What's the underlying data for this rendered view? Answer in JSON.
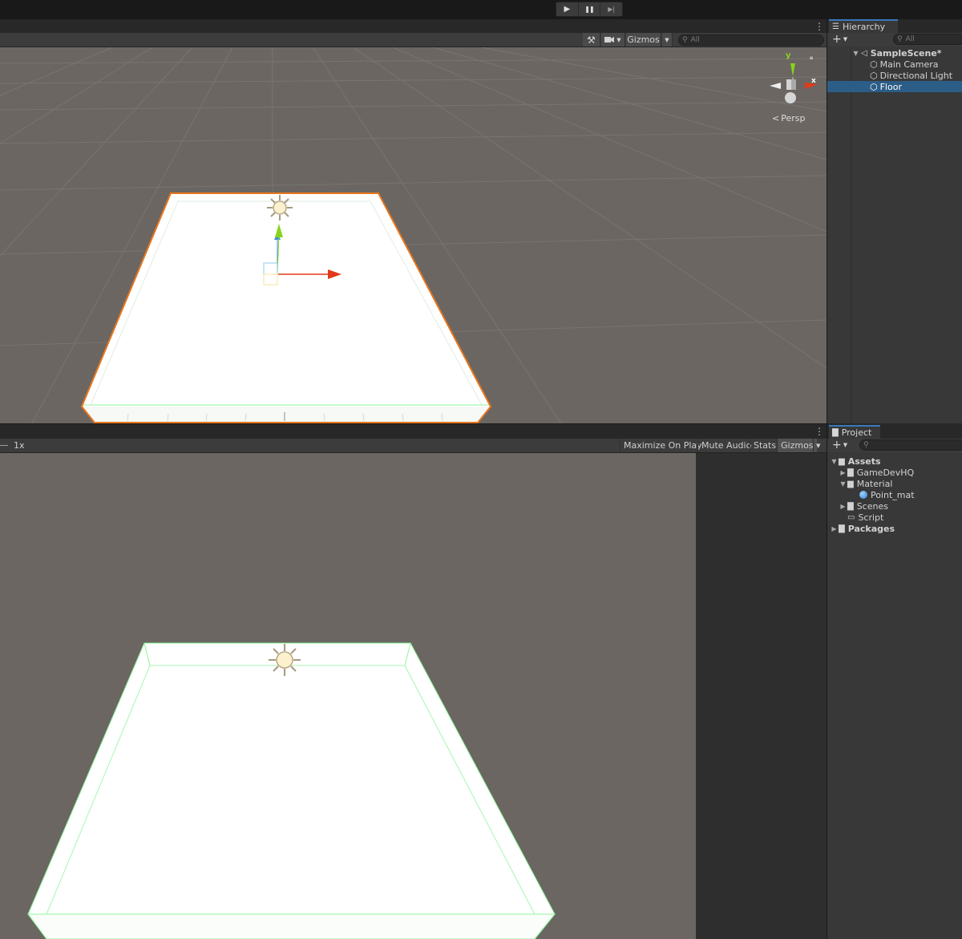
{
  "playbar": {
    "play": "▶",
    "pause": "❚❚",
    "step": "▶|"
  },
  "scene": {
    "gizmos_label": "Gizmos",
    "search_placeholder": "All",
    "projection_label": "Persp",
    "axis_y": "y",
    "axis_x": "x"
  },
  "game": {
    "scale_label": "1x",
    "buttons": [
      "Maximize On Play",
      "Mute Audio",
      "Stats",
      "Gizmos"
    ]
  },
  "hierarchy": {
    "tab_label": "Hierarchy",
    "search_placeholder": "All",
    "scene_name": "SampleScene*",
    "items": [
      "Main Camera",
      "Directional Light",
      "Floor"
    ],
    "selected": "Floor"
  },
  "project": {
    "tab_label": "Project",
    "tree": {
      "assets": "Assets",
      "gamedevhq": "GameDevHQ",
      "material": "Material",
      "point_mat": "Point_mat",
      "scenes": "Scenes",
      "script": "Script",
      "packages": "Packages"
    }
  },
  "colors": {
    "selection": "#2c5d87",
    "tab_accent": "#3a79bb",
    "viewport_bg": "#6b6662",
    "outline_orange": "#e9761c",
    "collider_green": "#8ef59a",
    "axis_x": "#e23a1a",
    "axis_y": "#86d41e",
    "axis_z": "#3a8ee0"
  }
}
